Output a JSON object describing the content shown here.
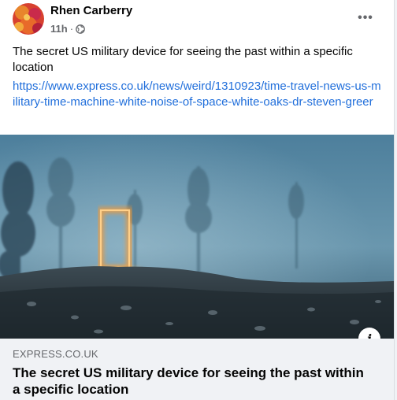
{
  "post": {
    "author": "Rhen Carberry",
    "time": "11h",
    "separator": "·",
    "audience_icon": "globe-icon",
    "more_icon": "more-horizontal-icon",
    "more_label": "•••",
    "message": "The secret US military device for seeing the past within a specific location",
    "link_url": "https://www.express.co.uk/news/weird/1310923/time-travel-news-us-military-time-machine-white-noise-of-space-white-oaks-dr-steven-greer"
  },
  "preview": {
    "info_label": "i",
    "domain": "EXPRESS.CO.UK",
    "title": "The secret US military device for seeing the past within a specific location"
  },
  "colors": {
    "link": "#216fdb",
    "text": "#050505",
    "secondary_text": "#65676b",
    "preview_bg": "#f0f2f5",
    "portal_glow": "#ffb14a"
  }
}
